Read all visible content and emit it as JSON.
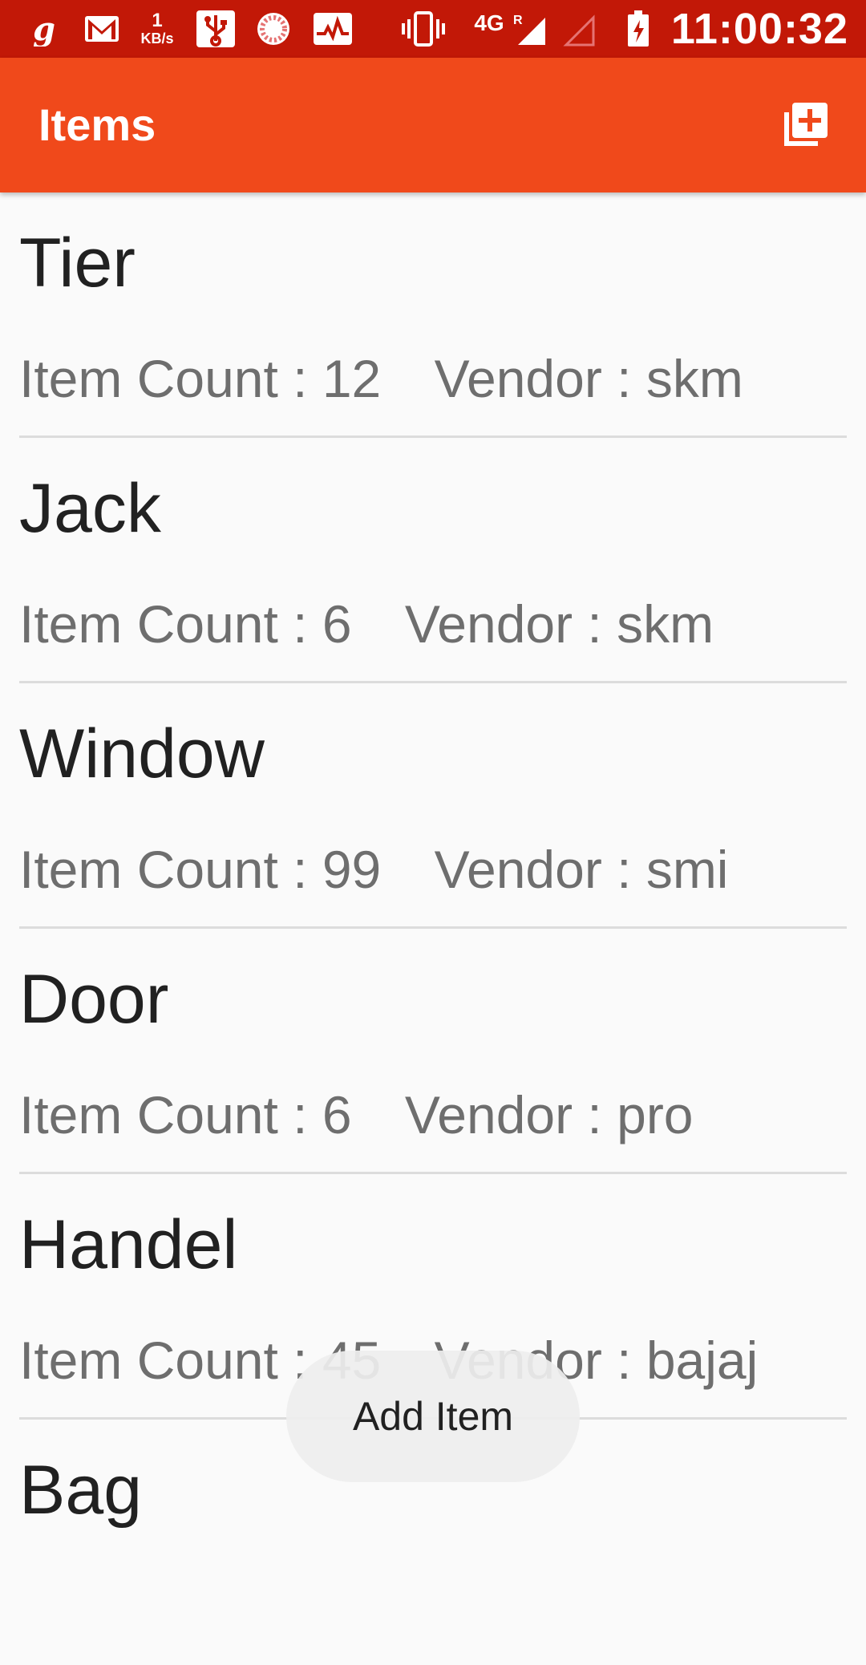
{
  "status_bar": {
    "network_speed_value": "1",
    "network_speed_unit": "KB/s",
    "network_type": "4G",
    "roaming_indicator": "R",
    "time": "11:00:32",
    "icons": [
      "g-app-icon",
      "gmail-icon",
      "usb-icon",
      "sync-icon",
      "activity-icon",
      "vibrate-icon",
      "signal-icon",
      "signal-empty-icon",
      "battery-charging-icon"
    ]
  },
  "app_bar": {
    "title": "Items",
    "action_icon": "add-to-library-icon"
  },
  "items": [
    {
      "name": "Tier",
      "count_label": "Item Count :",
      "count": "12",
      "vendor_label": "Vendor :",
      "vendor": "skm"
    },
    {
      "name": "Jack",
      "count_label": "Item Count :",
      "count": "6",
      "vendor_label": "Vendor :",
      "vendor": "skm"
    },
    {
      "name": "Window",
      "count_label": "Item Count :",
      "count": "99",
      "vendor_label": "Vendor :",
      "vendor": "smi"
    },
    {
      "name": "Door",
      "count_label": "Item Count :",
      "count": "6",
      "vendor_label": "Vendor :",
      "vendor": "pro"
    },
    {
      "name": "Handel",
      "count_label": "Item Count :",
      "count": "45",
      "vendor_label": "Vendor :",
      "vendor": "bajaj"
    },
    {
      "name": "Bag"
    }
  ],
  "toast": {
    "text": "Add Item"
  },
  "colors": {
    "status_bar": "#c21807",
    "app_bar": "#f0491b",
    "background": "#fafafa"
  }
}
